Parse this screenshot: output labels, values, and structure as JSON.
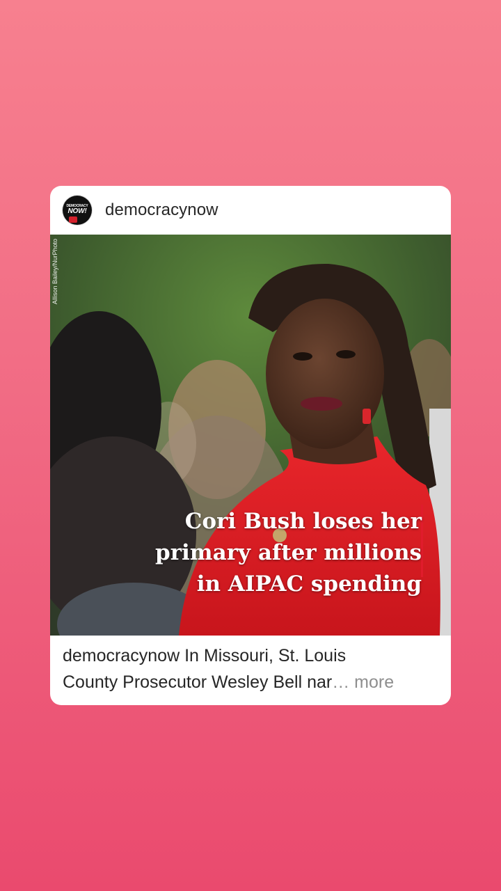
{
  "post": {
    "username": "democracynow",
    "avatar_text_top": "DEMOCRACY",
    "avatar_text_main": "NOW!",
    "photo_credit": "Allison Bailey/NurPhoto",
    "headline_lines": [
      "Cori Bush loses her",
      "primary after millions",
      "in AIPAC spending"
    ],
    "caption_user": "democracynow",
    "caption_line1": " In Missouri, St. Louis",
    "caption_line2": "County Prosecutor Wesley Bell nar",
    "caption_ellipsis": "…",
    "caption_more": " more"
  },
  "colors": {
    "background_top": "#f7808f",
    "background_bottom": "#ea4a6e",
    "headline_bar": "#e01c2c",
    "more_text": "#8e8e8e"
  }
}
